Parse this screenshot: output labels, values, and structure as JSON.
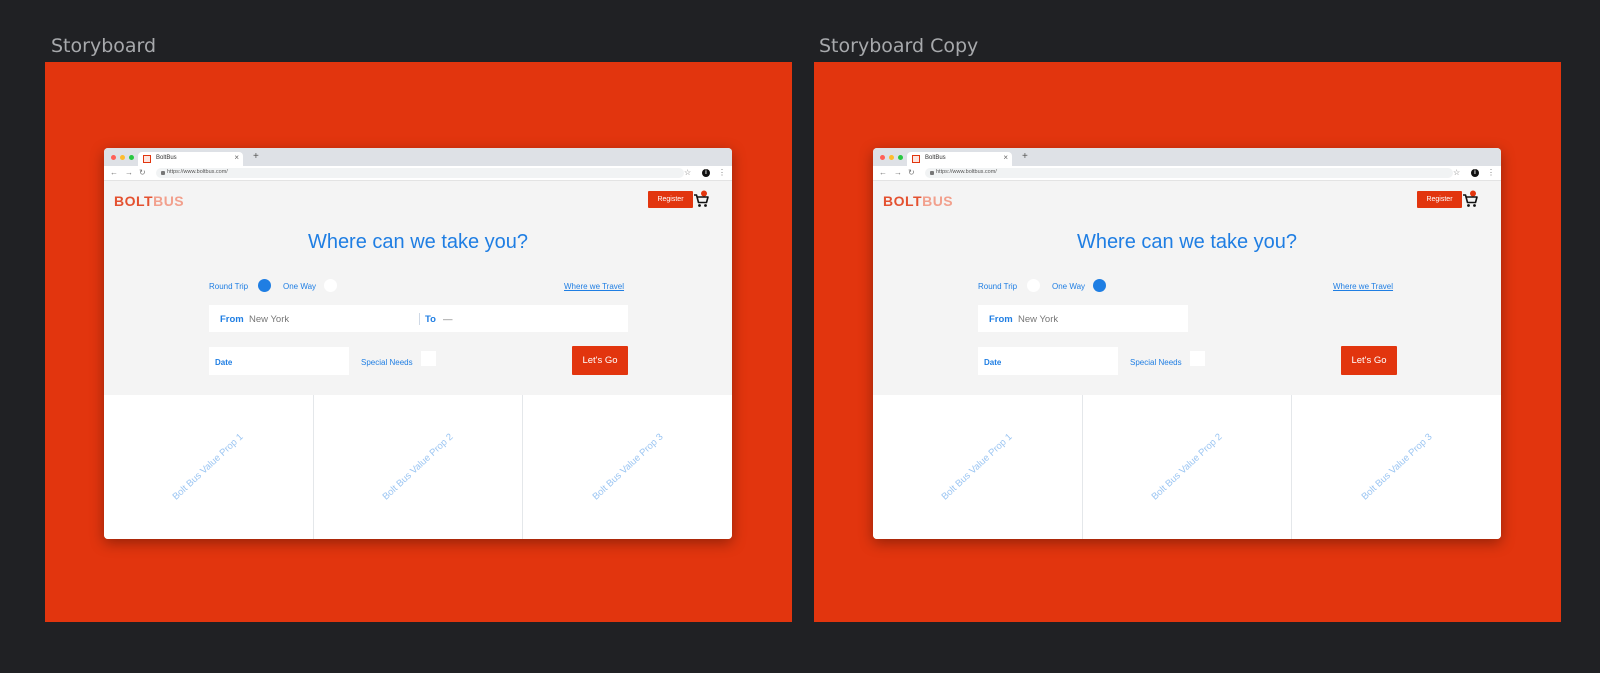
{
  "artboards": [
    {
      "title": "Storyboard",
      "browser": {
        "tab_title": "BoltBus",
        "url": "https://www.boltbus.com/"
      },
      "page": {
        "logo_part1": "BOLT",
        "logo_part2": "BUS",
        "register_label": "Register",
        "headline": "Where can we take you?",
        "round_trip_label": "Round Trip",
        "one_way_label": "One Way",
        "round_trip_selected": true,
        "where_we_travel": "Where we Travel",
        "from_label": "From",
        "from_value": "New York",
        "to_label": "To",
        "to_value": "—",
        "date_label": "Date",
        "special_needs_label": "Special Needs",
        "submit_label": "Let's Go",
        "value_props": [
          "Bolt Bus Value Prop 1",
          "Bolt Bus Value Prop 2",
          "Bolt Bus Value Prop 3"
        ]
      }
    },
    {
      "title": "Storyboard Copy",
      "browser": {
        "tab_title": "BoltBus",
        "url": "https://www.boltbus.com/"
      },
      "page": {
        "logo_part1": "BOLT",
        "logo_part2": "BUS",
        "register_label": "Register",
        "headline": "Where can we take you?",
        "round_trip_label": "Round Trip",
        "one_way_label": "One Way",
        "round_trip_selected": false,
        "where_we_travel": "Where we Travel",
        "from_label": "From",
        "from_value": "New York",
        "date_label": "Date",
        "special_needs_label": "Special Needs",
        "submit_label": "Let's Go",
        "value_props": [
          "Bolt Bus Value Prop 1",
          "Bolt Bus Value Prop 2",
          "Bolt Bus Value Prop 3"
        ]
      }
    }
  ],
  "colors": {
    "canvas": "#202124",
    "brand_red": "#e2350e",
    "brand_blue": "#1f7ee3"
  },
  "icons": [
    "back-arrow-icon",
    "forward-arrow-icon",
    "reload-icon",
    "lock-icon",
    "star-icon",
    "extension-icon",
    "menu-dots-icon",
    "shopping-cart-icon",
    "favicon-icon",
    "close-icon",
    "plus-icon"
  ]
}
